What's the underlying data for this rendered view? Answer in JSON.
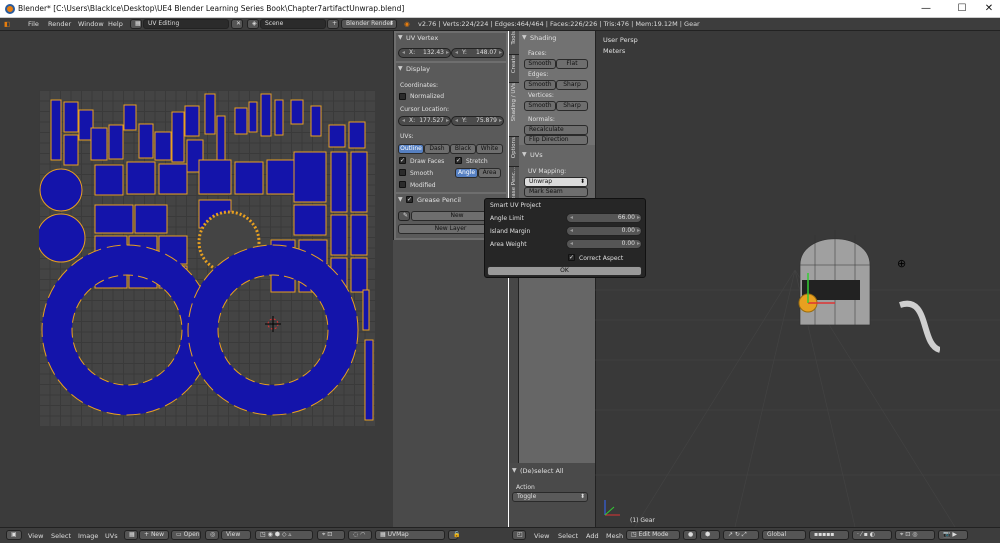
{
  "window": {
    "title": "Blender* [C:\\Users\\Blacklce\\Desktop\\UE4 Blender Learning Series Book\\Chapter7artifactUnwrap.blend]",
    "minimize": "—",
    "maximize": "☐",
    "close": "✕"
  },
  "menubar": {
    "menus": [
      "File",
      "Render",
      "Window",
      "Help"
    ],
    "layout": "UV Editing",
    "scene": "Scene",
    "engine": "Blender Render",
    "stats": "v2.76 | Verts:224/224 | Edges:464/464 | Faces:226/226 | Tris:476 | Mem:19.12M | Gear"
  },
  "uv_vertex_panel": {
    "header": "UV Vertex",
    "x_label": "X:",
    "x_value": "132.43",
    "y_label": "Y:",
    "y_value": "148.07"
  },
  "display_panel": {
    "header": "Display",
    "coordinates_label": "Coordinates:",
    "normalized": "Normalized",
    "cursor_location": "Cursor Location:",
    "cx_label": "X:",
    "cx_value": "177.527",
    "cy_label": "Y:",
    "cy_value": "75.879",
    "uvs_label": "UVs:",
    "uv_styles": [
      "Outline",
      "Dash",
      "Black",
      "White"
    ],
    "draw_faces": "Draw Faces",
    "stretch": "Stretch",
    "smooth": "Smooth",
    "angle": "Angle",
    "area": "Area",
    "modified": "Modified"
  },
  "grease_pencil": {
    "header": "Grease Pencil",
    "new": "New",
    "new_layer": "New Layer"
  },
  "tabs": [
    "Tools",
    "Create",
    "Shading / UVs",
    "Options",
    "Grease Penc..."
  ],
  "shading": {
    "header": "Shading",
    "faces": "Faces:",
    "edges": "Edges:",
    "vertices": "Vertices:",
    "smooth": "Smooth",
    "flat": "Flat",
    "sharp": "Sharp",
    "normals": "Normals:",
    "recalculate": "Recalculate",
    "flip": "Flip Direction"
  },
  "uvs_section": {
    "header": "UVs",
    "mapping": "UV Mapping:",
    "unwrap": "Unwrap",
    "mark_seam": "Mark Seam"
  },
  "deselect": {
    "header": "(De)select All",
    "action": "Action",
    "toggle": "Toggle"
  },
  "popup": {
    "title": "Smart UV Project",
    "angle_limit": "Angle Limit",
    "angle_value": "66.00",
    "island_margin": "Island Margin",
    "island_value": "0.00",
    "area_weight": "Area Weight",
    "area_value": "0.00",
    "correct_aspect": "Correct Aspect",
    "ok": "OK"
  },
  "view3d": {
    "persp": "User Persp",
    "units": "Meters",
    "object": "(1) Gear"
  },
  "footer": {
    "uv_menus": [
      "View",
      "Select",
      "Image",
      "UVs"
    ],
    "new": "New",
    "open": "Open",
    "view": "View",
    "uvmap": "UVMap",
    "mesh_menus": [
      "View",
      "Select",
      "Add",
      "Mesh"
    ],
    "mode": "Edit Mode",
    "orientation": "Global"
  },
  "colors": {
    "uv_face": "#1414aa",
    "uv_edge": "#e8a020",
    "selected_button": "#5680c2",
    "background": "#3b3b3b"
  }
}
